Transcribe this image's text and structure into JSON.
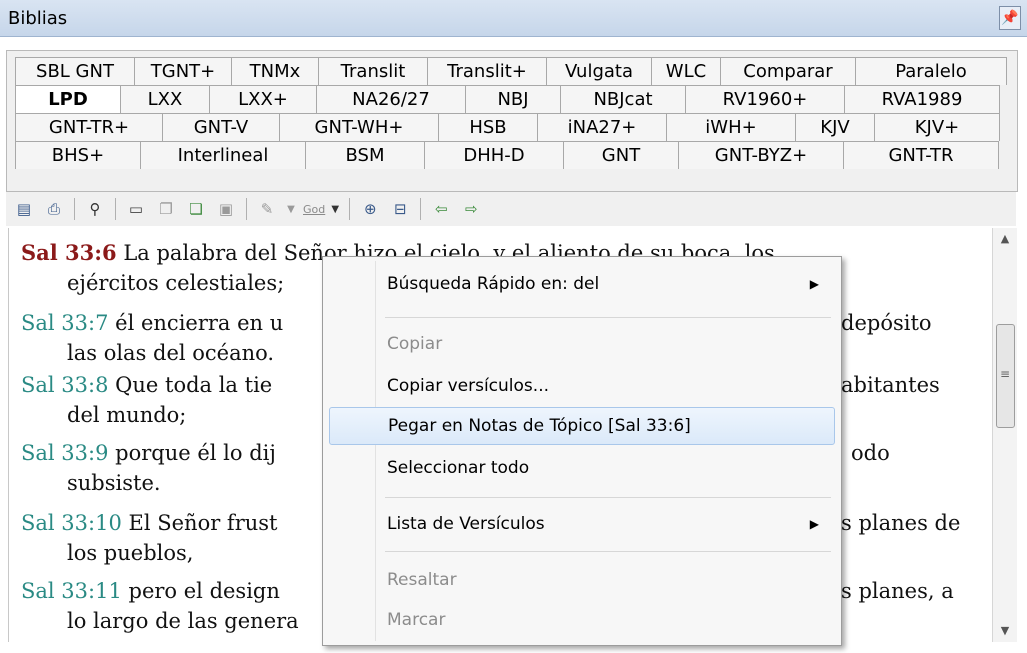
{
  "window": {
    "title": "Biblias",
    "pin_glyph": "📌"
  },
  "tabs": {
    "row1": [
      "SBL GNT",
      "TGNT+",
      "TNMx",
      "Translit",
      "Translit+",
      "Vulgata",
      "WLC",
      "Comparar",
      "Paralelo"
    ],
    "row2": [
      "LPD",
      "LXX",
      "LXX+",
      "NA26/27",
      "NBJ",
      "NBJcat",
      "RV1960+",
      "RVA1989"
    ],
    "row3": [
      "GNT-TR+",
      "GNT-V",
      "GNT-WH+",
      "HSB",
      "iNA27+",
      "iWH+",
      "KJV",
      "KJV+"
    ],
    "row4": [
      "BHS+",
      "Interlineal",
      "BSM",
      "DHH-D",
      "GNT",
      "GNT-BYZ+",
      "GNT-TR"
    ],
    "active": "LPD"
  },
  "toolbar": {
    "icons": [
      "properties-icon",
      "print-icon",
      "find-icon",
      "page-icon",
      "copy-icon",
      "paste-icon",
      "paste-special-icon",
      "highlight-icon",
      "god-format-icon",
      "zoom-icon",
      "split-view-icon",
      "back-icon",
      "forward-icon"
    ],
    "god_label": "God"
  },
  "verses": [
    {
      "ref": "Sal 33:6",
      "line1": "La palabra del Señor hizo el cielo, y el aliento de su boca, los",
      "line2": "ejércitos celestiales;"
    },
    {
      "ref": "Sal 33:7",
      "line1": "él encierra en u",
      "line1_tail": "depósito",
      "line2": "las olas del océano."
    },
    {
      "ref": "Sal 33:8",
      "line1": "Que toda la tie",
      "line1_tail": "abitantes",
      "line2": "del mundo;"
    },
    {
      "ref": "Sal 33:9",
      "line1": "porque él lo dij",
      "line1_tail": "odo",
      "line2": "subsiste."
    },
    {
      "ref": "Sal 33:10",
      "line1": "El Señor frust",
      "line1_tail": "s planes de",
      "line2": "los pueblos,"
    },
    {
      "ref": "Sal 33:11",
      "line1": "pero el design",
      "line1_tail": "s planes, a",
      "line2": "lo largo de las genera"
    }
  ],
  "context_menu": {
    "items": [
      {
        "label": "Búsqueda Rápido en: del",
        "submenu": true,
        "disabled": false
      },
      {
        "label": "Copiar",
        "submenu": false,
        "disabled": true
      },
      {
        "label": "Copiar versículos...",
        "submenu": false,
        "disabled": false
      },
      {
        "label": "Pegar en Notas de Tópico [Sal 33:6]",
        "submenu": false,
        "disabled": false,
        "hover": true
      },
      {
        "label": "Seleccionar todo",
        "submenu": false,
        "disabled": false
      },
      {
        "label": "Lista de Versículos",
        "submenu": true,
        "disabled": false
      },
      {
        "label": "Resaltar",
        "submenu": false,
        "disabled": true
      },
      {
        "label": "Marcar",
        "submenu": false,
        "disabled": true
      }
    ],
    "arrow_glyph": "▶"
  },
  "colors": {
    "current_ref": "#8b1a1a",
    "ref": "#2a8a84",
    "titlebar": "#c6d6ea"
  }
}
